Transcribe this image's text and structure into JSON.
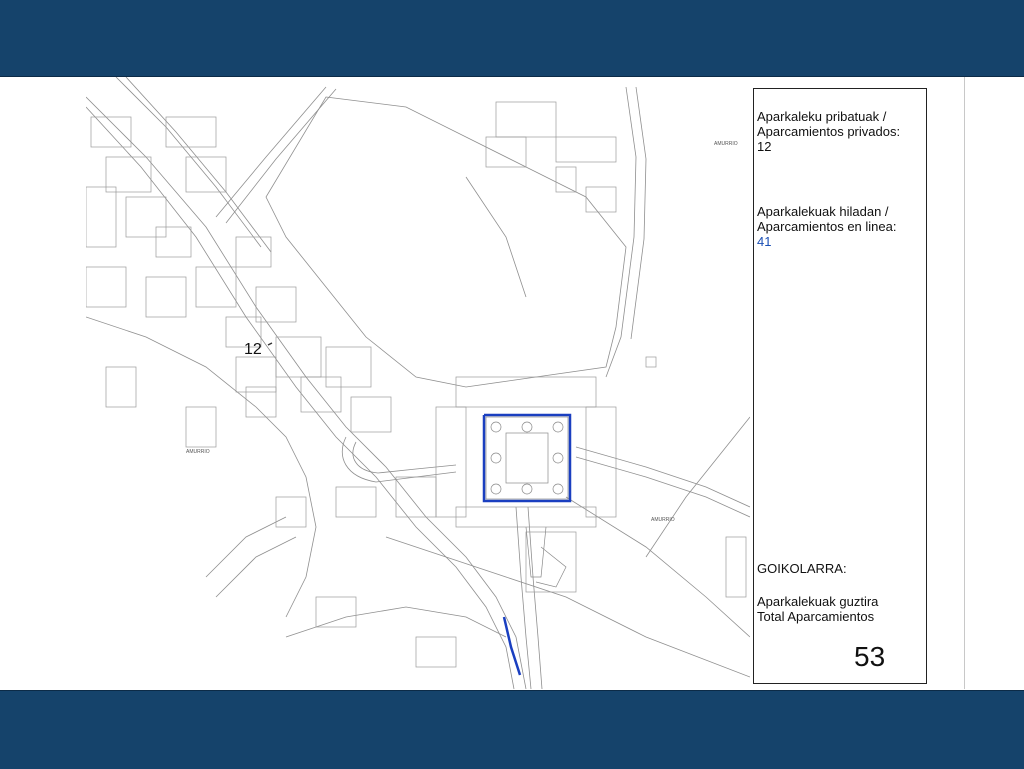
{
  "legend": {
    "private_parking_label_1": "Aparkaleku pribatuak /",
    "private_parking_label_2": "Aparcamientos privados:",
    "private_parking_count": "12",
    "line_parking_label_1": "Aparkalekuak hiladan /",
    "line_parking_label_2": "Aparcamientos en linea:",
    "line_parking_count": "41",
    "area_name": "GOIKOLARRA:",
    "total_label_1": "Aparkalekuak guztira",
    "total_label_2": "Total Aparcamientos",
    "total_count": "53"
  },
  "map": {
    "private_parking_marker": "12",
    "place_labels": [
      "AMURRIO",
      "AMURRIO",
      "AMURRIO"
    ]
  },
  "colors": {
    "band": "#15436b",
    "parking_line": "#1a3fc0",
    "map_line": "#8a8a8a",
    "count_blue": "#1a4fb5"
  }
}
